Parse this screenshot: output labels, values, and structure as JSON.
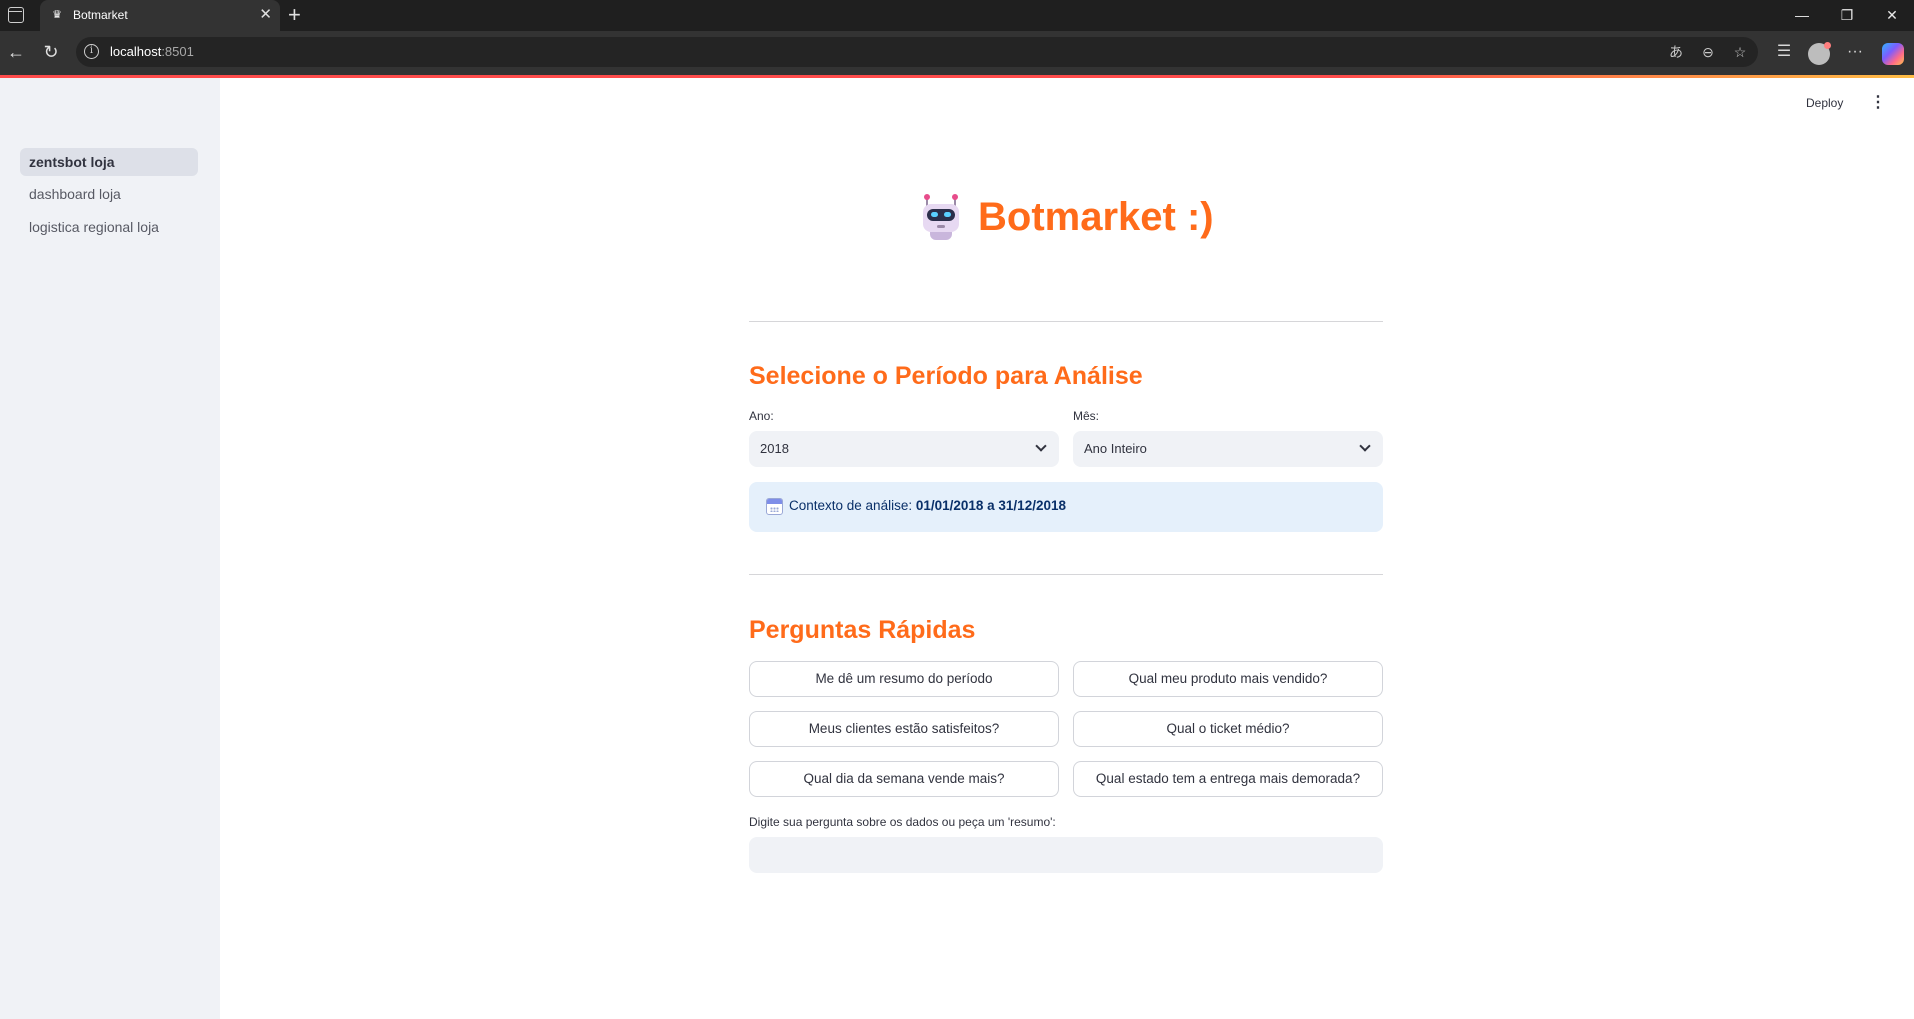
{
  "browser": {
    "tab_title": "Botmarket",
    "url_host": "localhost",
    "url_port": ":8501"
  },
  "sidebar": {
    "items": [
      {
        "label": "zentsbot loja",
        "active": true
      },
      {
        "label": "dashboard loja",
        "active": false
      },
      {
        "label": "logistica regional loja",
        "active": false
      }
    ]
  },
  "header": {
    "deploy_label": "Deploy"
  },
  "hero": {
    "title": "Botmarket :)",
    "icon": "robot-icon"
  },
  "period": {
    "title": "Selecione o Período para Análise",
    "year_label": "Ano:",
    "year_value": "2018",
    "month_label": "Mês:",
    "month_value": "Ano Inteiro",
    "context_prefix": "Contexto de análise: ",
    "context_range": "01/01/2018 a 31/12/2018"
  },
  "quick": {
    "title": "Perguntas Rápidas",
    "buttons": [
      "Me dê um resumo do período",
      "Qual meu produto mais vendido?",
      "Meus clientes estão satisfeitos?",
      "Qual o ticket médio?",
      "Qual dia da semana vende mais?",
      "Qual estado tem a entrega mais demorada?"
    ]
  },
  "chat": {
    "label": "Digite sua pergunta sobre os dados ou peça um 'resumo':",
    "value": ""
  },
  "colors": {
    "accent_orange": "#ff6b1a",
    "streamlit_red": "#ff4b4b",
    "info_bg": "#e5f0fb"
  }
}
